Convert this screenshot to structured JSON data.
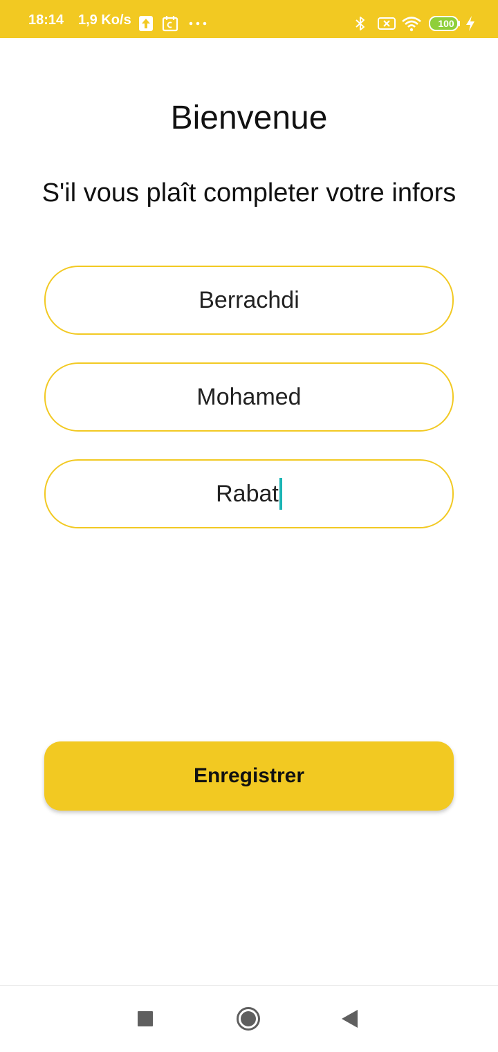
{
  "status_bar": {
    "time": "18:14",
    "network_speed": "1,9 Ko/s",
    "battery_level": "100",
    "icons": [
      "upload-icon",
      "calendar-icon",
      "more-dots-icon",
      "bluetooth-icon",
      "no-sim-icon",
      "wifi-icon",
      "battery-icon",
      "charging-icon"
    ],
    "background_color": "#f2c922"
  },
  "main": {
    "title": "Bienvenue",
    "subtitle": "S'il vous plaît completer votre infors",
    "fields": [
      {
        "value": "Berrachdi"
      },
      {
        "value": "Mohamed"
      },
      {
        "value": "Rabat",
        "focused": true
      }
    ],
    "save_label": "Enregistrer"
  },
  "nav_bar": {
    "icons": [
      "recents-icon",
      "home-icon",
      "back-icon"
    ]
  },
  "colors": {
    "accent": "#f2c922",
    "cursor": "#1bb5b5"
  }
}
